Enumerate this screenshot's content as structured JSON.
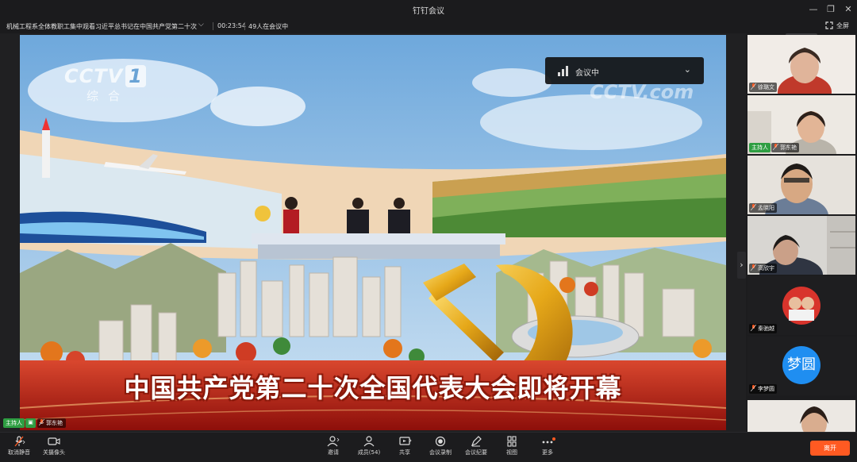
{
  "app": {
    "title": "钉钉会议"
  },
  "infobar": {
    "meeting_title": "机械工程系全体教职工集中观看习近平总书记在中国共产党第二十次",
    "timer": "00:23:54",
    "participants_text": "49人在会议中",
    "fullscreen_label": "全屏"
  },
  "video": {
    "channel_logo": "CCTV",
    "channel_number": "1",
    "channel_sub": "综合",
    "watermark": "CCTV.com",
    "status_label": "会议中",
    "caption": "中国共产党第二十次全国代表大会即将开幕",
    "host_badge": "主持人",
    "speaker_name": "郭东艳"
  },
  "participants": [
    {
      "name": "徐璐文",
      "host": false
    },
    {
      "name": "郭东艳",
      "host": true,
      "host_label": "主持人"
    },
    {
      "name": "孟晓阳",
      "host": false
    },
    {
      "name": "高欣宇",
      "host": false
    },
    {
      "name": "秦驰越",
      "host": false
    },
    {
      "name": "李梦圆",
      "host": false,
      "avatar_text": "梦圆"
    },
    {
      "name": "",
      "host": false
    }
  ],
  "toolbar": {
    "mute": "取消静音",
    "camera": "关摄像头",
    "invite": "邀请",
    "members": "成员(54)",
    "share": "共享",
    "record": "会议录制",
    "minutes": "会议纪要",
    "view": "视图",
    "more": "更多",
    "leave": "离开"
  },
  "colors": {
    "accent": "#ff5a22",
    "host_green": "#2e9e42",
    "avatar_blue": "#1f8ef1"
  }
}
